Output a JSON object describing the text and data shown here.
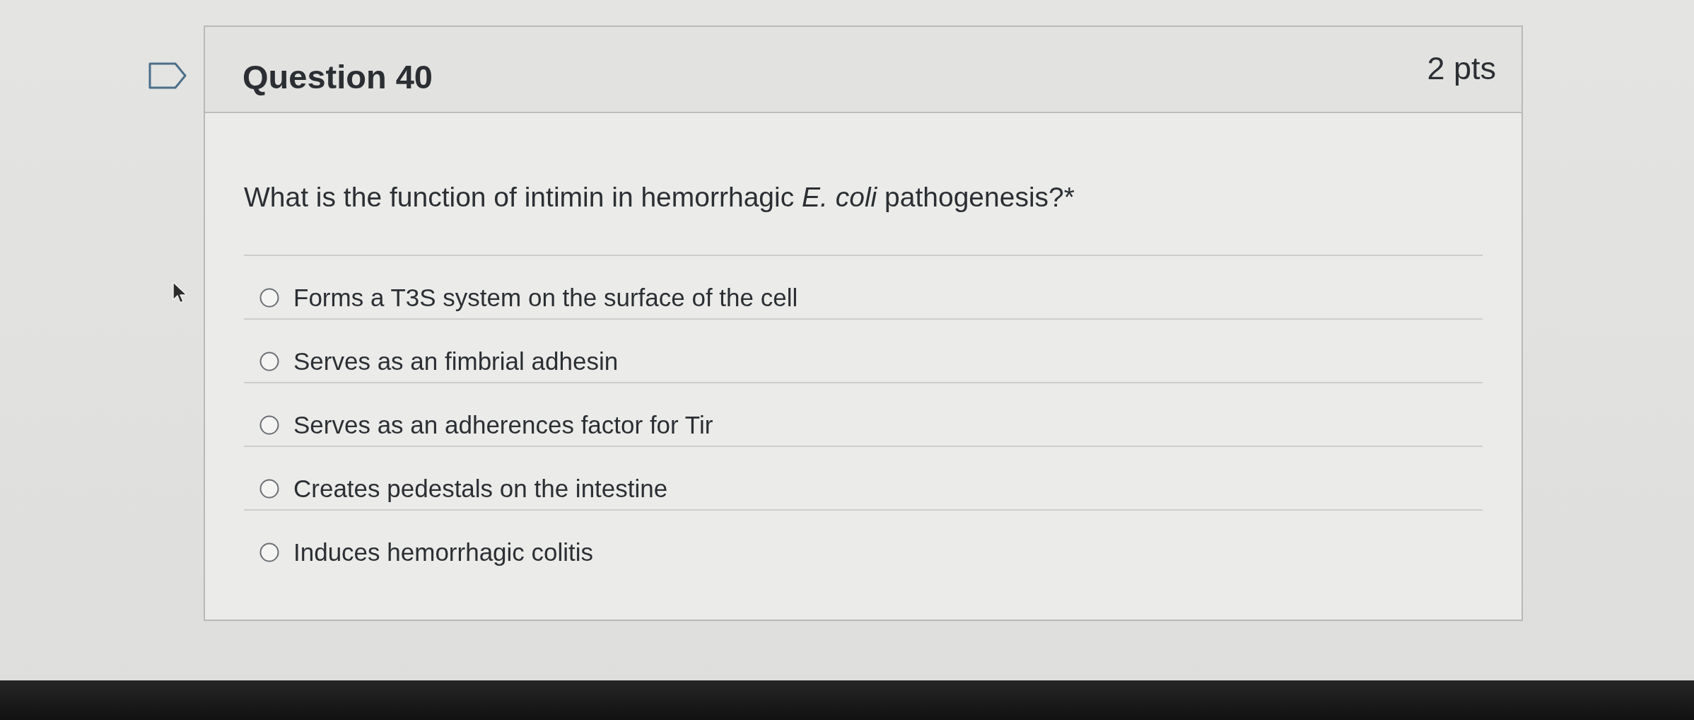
{
  "question": {
    "flagged": false,
    "title": "Question 40",
    "points": "2 pts",
    "prompt": "What is the function of intimin in hemorrhagic *E. coli* pathogenesis?*",
    "answers": [
      {
        "label": "Forms a T3S system on the surface of the cell",
        "selected": false
      },
      {
        "label": "Serves as an fimbrial adhesin",
        "selected": false
      },
      {
        "label": "Serves as an adherences factor for Tir",
        "selected": false
      },
      {
        "label": "Creates pedestals on the intestine",
        "selected": false
      },
      {
        "label": "Induces hemorrhagic colitis",
        "selected": false
      }
    ]
  }
}
